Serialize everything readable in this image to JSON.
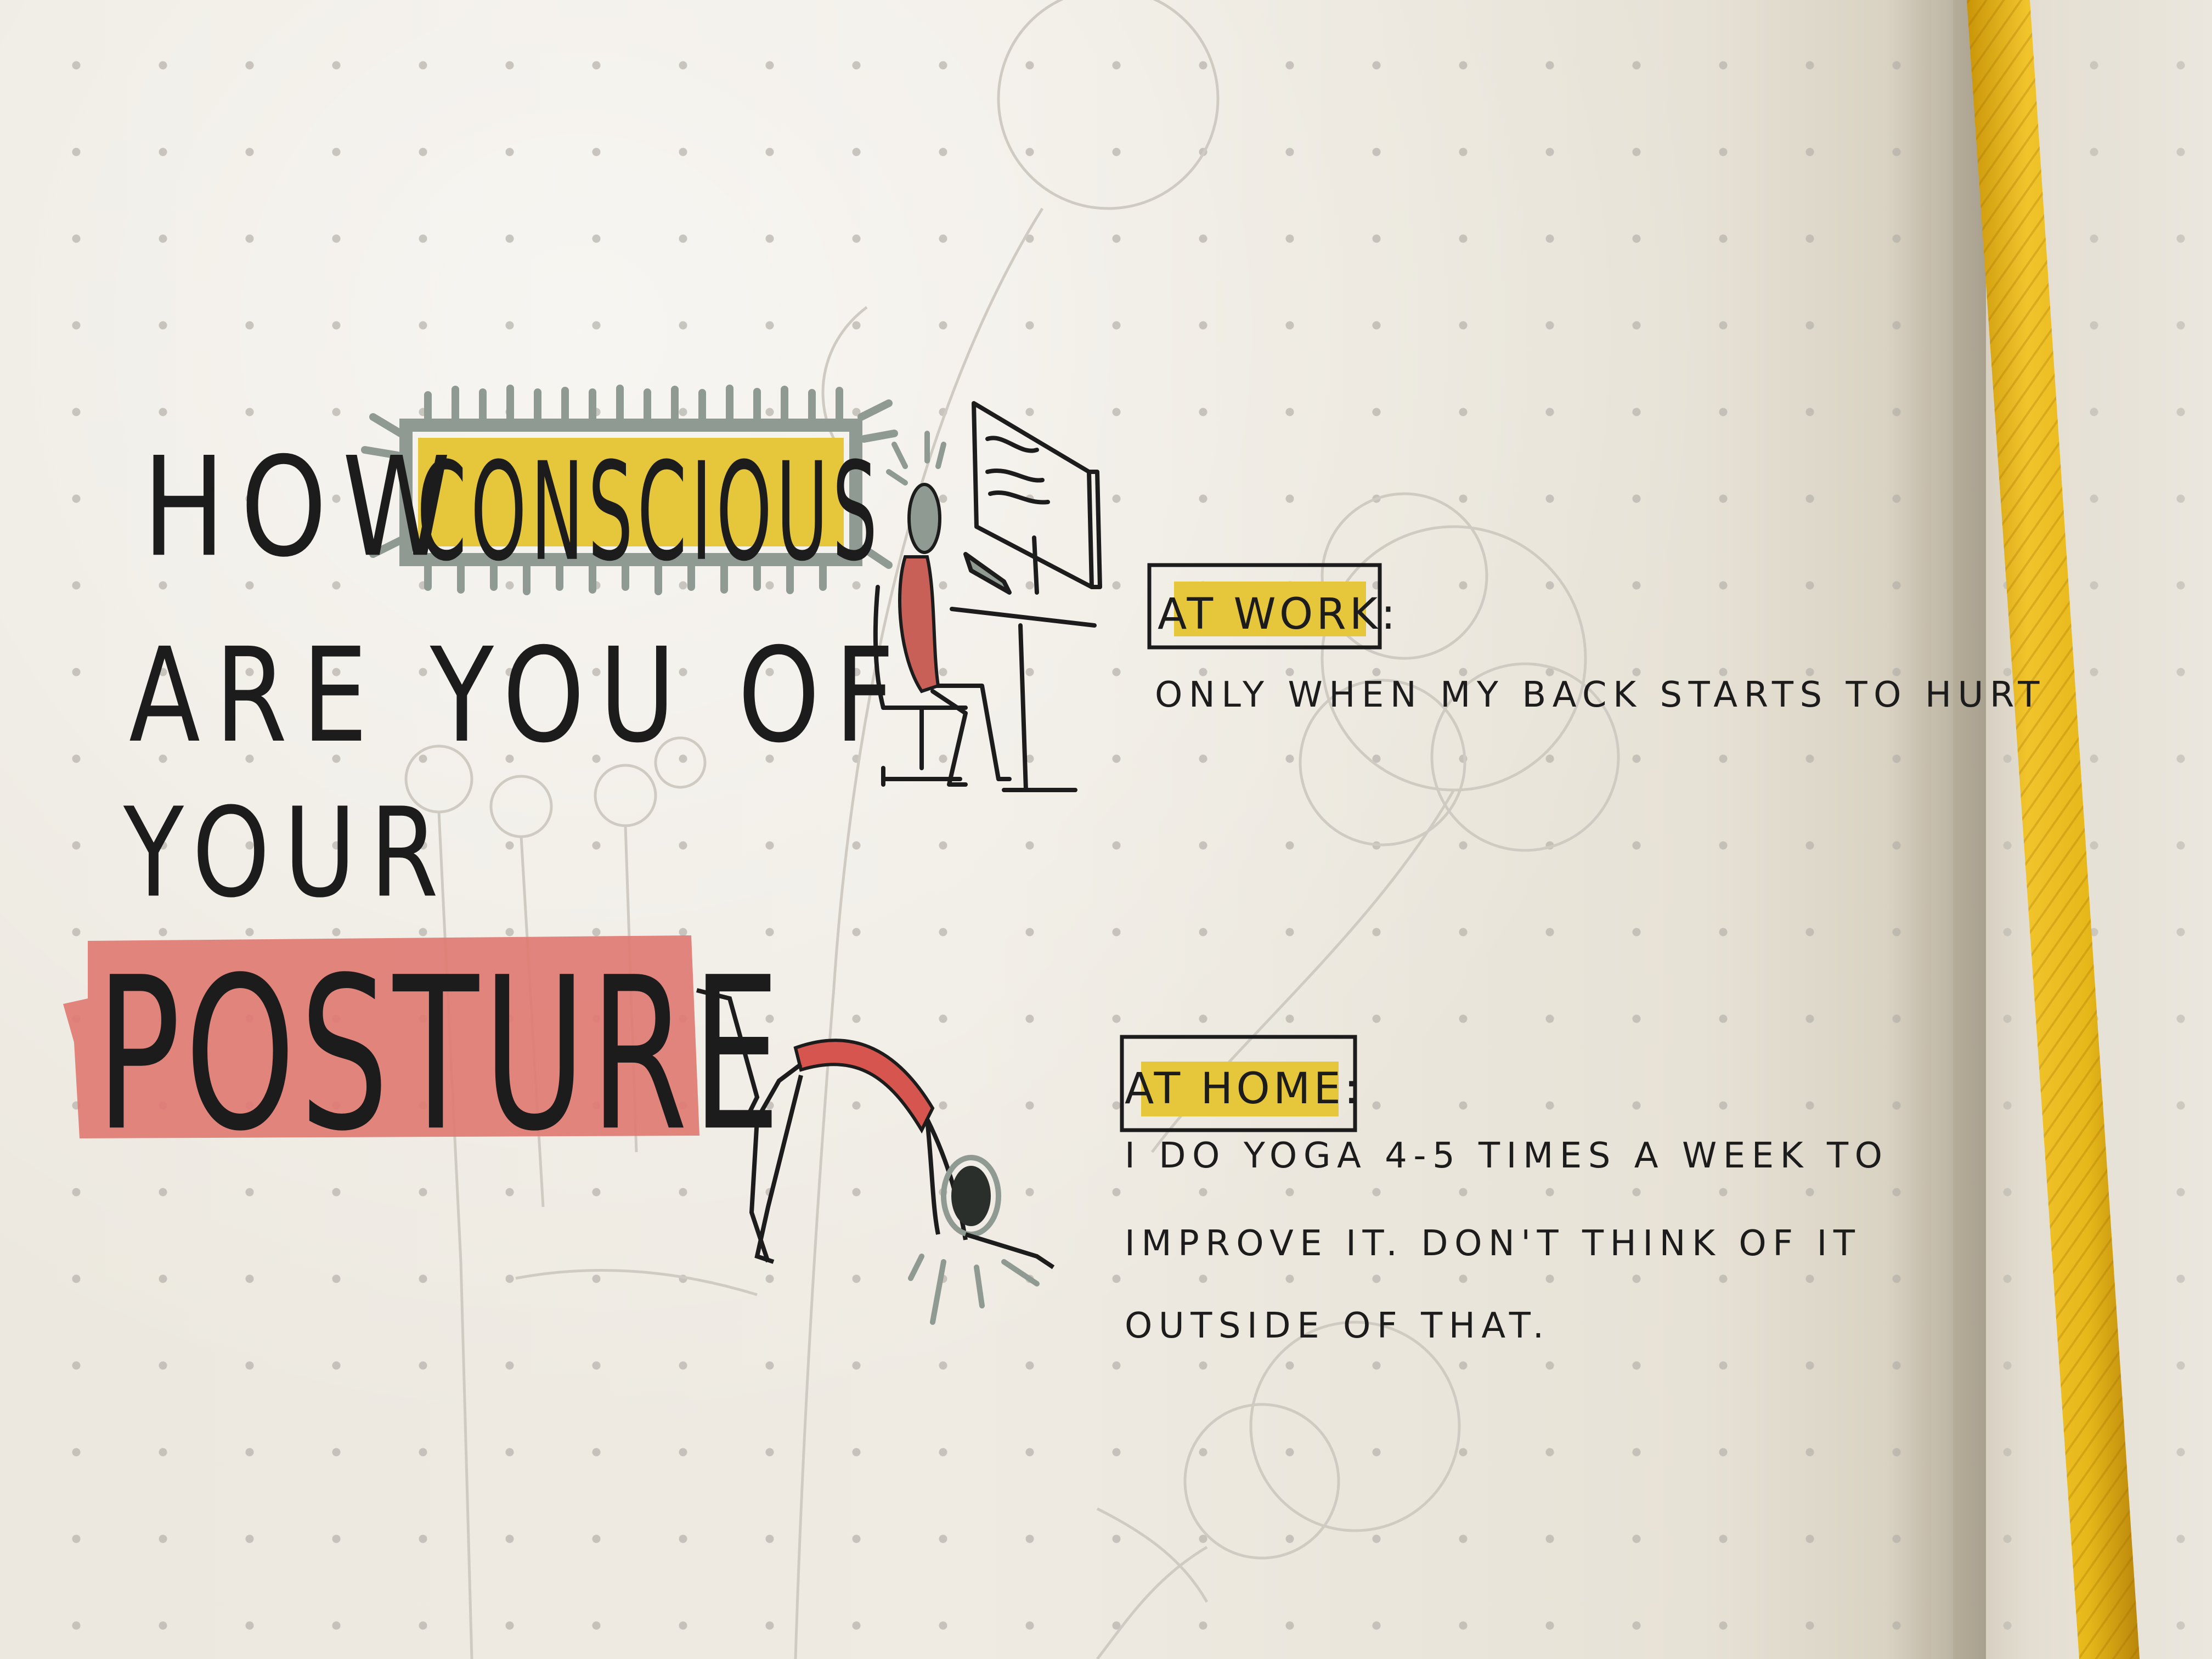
{
  "title": {
    "word_how": "HOW",
    "word_conscious": "CONSCIOUS",
    "line2": "ARE YOU OF",
    "line3": "YOUR",
    "word_posture": "POSTURE"
  },
  "sections": {
    "work": {
      "label": "AT WORK:",
      "text": "ONLY WHEN MY BACK STARTS TO HURT"
    },
    "home": {
      "label": "AT HOME:",
      "lines": [
        "I DO YOGA 4-5 TIMES A WEEK TO",
        "IMPROVE IT. DON'T THINK OF IT",
        "OUTSIDE OF THAT."
      ]
    }
  },
  "colors": {
    "paper": "#eeeae2",
    "dot": "#b9b5ae",
    "ink": "#1c1c1c",
    "yellow_highlight": "#e6c63a",
    "red_highlight": "#df7b73",
    "grey_marker": "#8f9a92",
    "ribbon": "#e7b81a"
  }
}
